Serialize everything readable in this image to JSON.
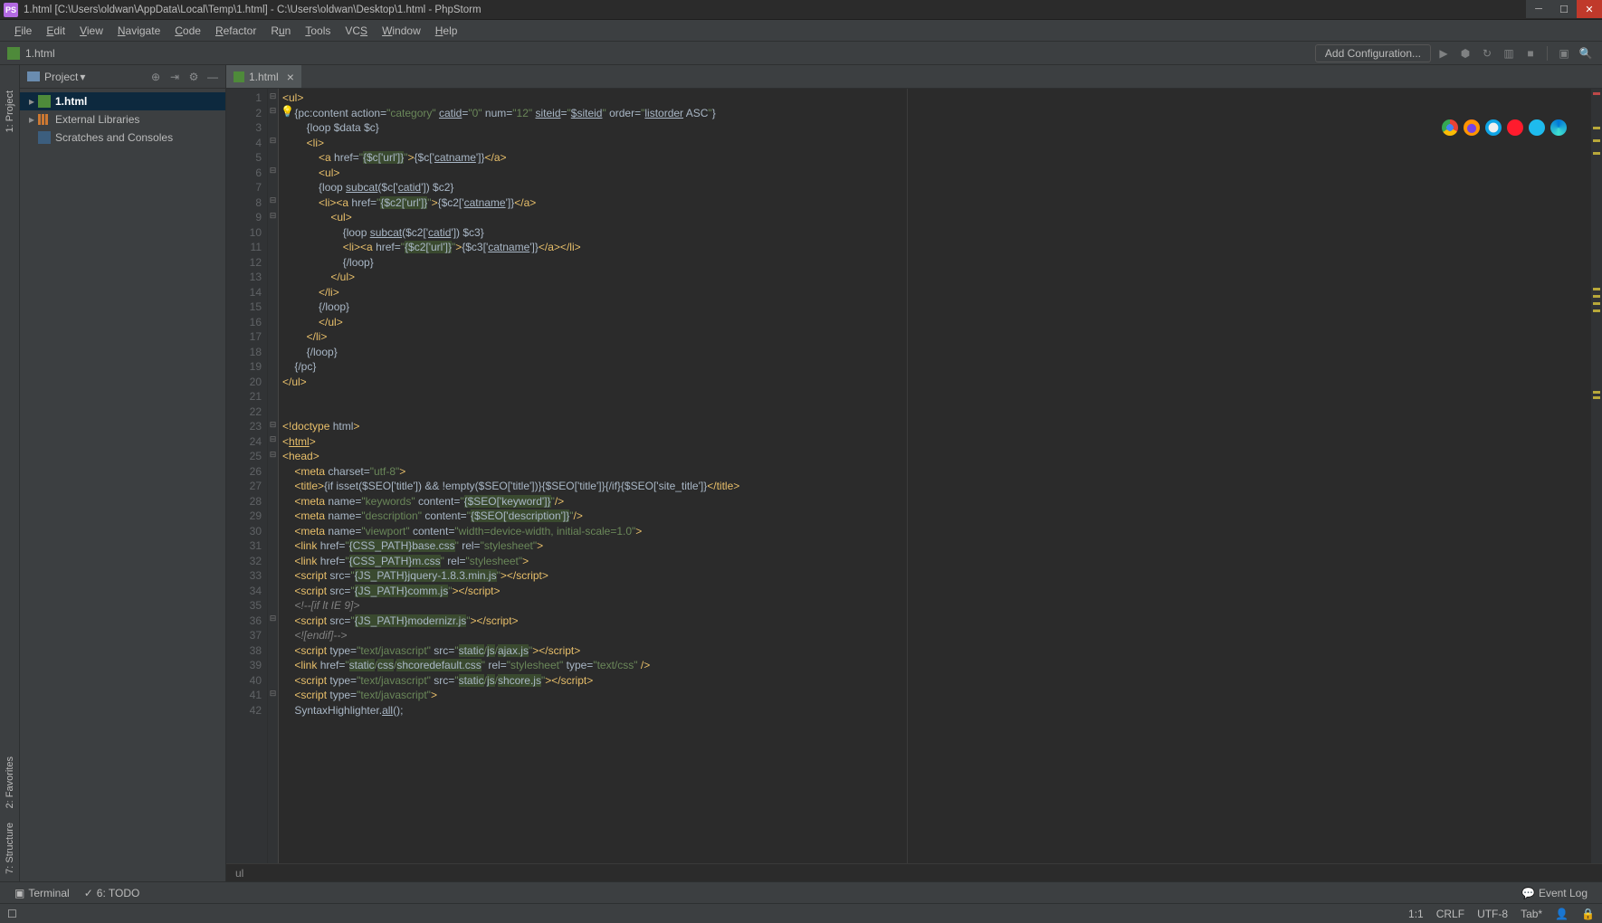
{
  "titlebar": {
    "text": "1.html [C:\\Users\\oldwan\\AppData\\Local\\Temp\\1.html] - C:\\Users\\oldwan\\Desktop\\1.html - PhpStorm"
  },
  "menu": {
    "items": [
      "File",
      "Edit",
      "View",
      "Navigate",
      "Code",
      "Refactor",
      "Run",
      "Tools",
      "VCS",
      "Window",
      "Help"
    ]
  },
  "navbar": {
    "file": "1.html",
    "addConfig": "Add Configuration..."
  },
  "leftTabs": {
    "project": "1: Project",
    "favorites": "2: Favorites",
    "structure": "7: Structure"
  },
  "projectPanel": {
    "title": "Project",
    "tree": {
      "root": "1.html",
      "ext": "External Libraries",
      "scratch": "Scratches and Consoles"
    }
  },
  "tabs": {
    "active": "1.html"
  },
  "gutterStart": 1,
  "gutterEnd": 42,
  "code": {
    "lines": [
      {
        "n": 1,
        "html": "<span class='t'>&lt;ul&gt;</span>"
      },
      {
        "n": 2,
        "html": "    <span class='a'>{pc:content action=</span><span class='s'>\"category\"</span> <span class='a u'>catid</span><span class='a'>=</span><span class='s'>\"0\"</span> <span class='a'>num=</span><span class='s'>\"12\"</span> <span class='a u'>siteid</span><span class='a'>=</span><span class='s'>\"</span><span class='a u'>$siteid</span><span class='s'>\"</span> <span class='a'>order=</span><span class='s'>\"</span><span class='a u'>listorder</span> <span class='a'>ASC</span><span class='s'>\"</span><span class='a'>}</span>"
      },
      {
        "n": 3,
        "html": "        <span class='a'>{loop $data $c}</span>"
      },
      {
        "n": 4,
        "html": "        <span class='t'>&lt;li&gt;</span>"
      },
      {
        "n": 5,
        "html": "            <span class='t'>&lt;a </span><span class='a'>href=</span><span class='s'>\"</span><span class='sh'>{$c['url']}</span><span class='s'>\"</span><span class='t'>&gt;</span><span class='a'>{$c['</span><span class='a u'>catname</span><span class='a'>']}</span><span class='t'>&lt;/a&gt;</span>"
      },
      {
        "n": 6,
        "html": "            <span class='t'>&lt;ul&gt;</span>"
      },
      {
        "n": 7,
        "html": "            <span class='a'>{loop </span><span class='a u'>subcat</span><span class='a'>($c['</span><span class='a u'>catid</span><span class='a'>']) $c2}</span>"
      },
      {
        "n": 8,
        "html": "            <span class='t'>&lt;li&gt;&lt;a </span><span class='a'>href=</span><span class='s'>\"</span><span class='sh'>{$c2['url']}</span><span class='s'>\"</span><span class='t'>&gt;</span><span class='a'>{$c2['</span><span class='a u'>catname</span><span class='a'>']}</span><span class='t'>&lt;/a&gt;</span>"
      },
      {
        "n": 9,
        "html": "                <span class='t'>&lt;ul&gt;</span>"
      },
      {
        "n": 10,
        "html": "                    <span class='a'>{loop </span><span class='a u'>subcat</span><span class='a'>($c2['</span><span class='a u'>catid</span><span class='a'>']) $c3}</span>"
      },
      {
        "n": 11,
        "html": "                    <span class='t'>&lt;li&gt;&lt;a </span><span class='a'>href=</span><span class='s'>\"</span><span class='sh'>{$c2['url']}</span><span class='s'>\"</span><span class='t'>&gt;</span><span class='a'>{$c3['</span><span class='a u'>catname</span><span class='a'>']}</span><span class='t'>&lt;/a&gt;&lt;/li&gt;</span>"
      },
      {
        "n": 12,
        "html": "                    <span class='a'>{/loop}</span>"
      },
      {
        "n": 13,
        "html": "                <span class='t'>&lt;/ul&gt;</span>"
      },
      {
        "n": 14,
        "html": "            <span class='t'>&lt;/li&gt;</span>"
      },
      {
        "n": 15,
        "html": "            <span class='a'>{/loop}</span>"
      },
      {
        "n": 16,
        "html": "            <span class='t'>&lt;/ul&gt;</span>"
      },
      {
        "n": 17,
        "html": "        <span class='t'>&lt;/li&gt;</span>"
      },
      {
        "n": 18,
        "html": "        <span class='a'>{/loop}</span>"
      },
      {
        "n": 19,
        "html": "    <span class='a'>{/pc}</span>"
      },
      {
        "n": 20,
        "html": "<span class='t'>&lt;/ul&gt;</span>"
      },
      {
        "n": 21,
        "html": ""
      },
      {
        "n": 22,
        "html": ""
      },
      {
        "n": 23,
        "html": "<span class='t'>&lt;!doctype </span><span class='a'>html</span><span class='t'>&gt;</span>"
      },
      {
        "n": 24,
        "html": "<span class='t'>&lt;</span><span class='t u'>html</span><span class='t'>&gt;</span>"
      },
      {
        "n": 25,
        "html": "<span class='t'>&lt;head&gt;</span>"
      },
      {
        "n": 26,
        "html": "    <span class='t'>&lt;meta </span><span class='a'>charset=</span><span class='s'>\"utf-8\"</span><span class='t'>&gt;</span>"
      },
      {
        "n": 27,
        "html": "    <span class='t'>&lt;title&gt;</span><span class='a'>{if isset($SEO['title']) && !empty($SEO['title'])}{$SEO['title']}{/if}{$SEO['site_title']}</span><span class='t'>&lt;/title&gt;</span>"
      },
      {
        "n": 28,
        "html": "    <span class='t'>&lt;meta </span><span class='a'>name=</span><span class='s'>\"keywords\"</span> <span class='a'>content=</span><span class='s'>\"</span><span class='sh'>{$SEO['keyword']}</span><span class='s'>\"</span><span class='t'>/&gt;</span>"
      },
      {
        "n": 29,
        "html": "    <span class='t'>&lt;meta </span><span class='a'>name=</span><span class='s'>\"description\"</span> <span class='a'>content=</span><span class='s'>\"</span><span class='sh'>{$SEO['description']}</span><span class='s'>\"</span><span class='t'>/&gt;</span>"
      },
      {
        "n": 30,
        "html": "    <span class='t'>&lt;meta </span><span class='a'>name=</span><span class='s'>\"viewport\"</span> <span class='a'>content=</span><span class='s'>\"width=device-width, initial-scale=1.0\"</span><span class='t'>&gt;</span>"
      },
      {
        "n": 31,
        "html": "    <span class='t'>&lt;link </span><span class='a'>href=</span><span class='s'>\"</span><span class='sh'>{CSS_PATH}base.css</span><span class='s'>\"</span> <span class='a'>rel=</span><span class='s'>\"stylesheet\"</span><span class='t'>&gt;</span>"
      },
      {
        "n": 32,
        "html": "    <span class='t'>&lt;link </span><span class='a'>href=</span><span class='s'>\"</span><span class='sh'>{CSS_PATH}m.css</span><span class='s'>\"</span> <span class='a'>rel=</span><span class='s'>\"stylesheet\"</span><span class='t'>&gt;</span>"
      },
      {
        "n": 33,
        "html": "    <span class='t'>&lt;script </span><span class='a'>src=</span><span class='s'>\"</span><span class='sh'>{JS_PATH}jquery-1.8.3.min.js</span><span class='s'>\"</span><span class='t'>&gt;&lt;/script&gt;</span>"
      },
      {
        "n": 34,
        "html": "    <span class='t'>&lt;script </span><span class='a'>src=</span><span class='s'>\"</span><span class='sh'>{JS_PATH}comm.js</span><span class='s'>\"</span><span class='t'>&gt;&lt;/script&gt;</span>"
      },
      {
        "n": 35,
        "html": "    <span class='ci'>&lt;!--[if lt IE 9]&gt;</span>"
      },
      {
        "n": 36,
        "html": "    <span class='t'>&lt;script </span><span class='a'>src=</span><span class='s'>\"</span><span class='sh'>{JS_PATH}modernizr.js</span><span class='s'>\"</span><span class='t'>&gt;&lt;/script&gt;</span>"
      },
      {
        "n": 37,
        "html": "    <span class='ci'>&lt;![endif]--&gt;</span>"
      },
      {
        "n": 38,
        "html": "    <span class='t'>&lt;script </span><span class='a'>type=</span><span class='s'>\"text/javascript\"</span> <span class='a'>src=</span><span class='s'>\"</span><span class='sh'>static</span><span class='s'>/</span><span class='sh'>js</span><span class='s'>/</span><span class='sh'>ajax.js</span><span class='s'>\"</span><span class='t'>&gt;&lt;/script&gt;</span>"
      },
      {
        "n": 39,
        "html": "    <span class='t'>&lt;link </span><span class='a'>href=</span><span class='s'>\"</span><span class='sh'>static</span><span class='s'>/</span><span class='sh'>css</span><span class='s'>/</span><span class='sh'>shcoredefault.css</span><span class='s'>\"</span> <span class='a'>rel=</span><span class='s'>\"stylesheet\"</span> <span class='a'>type=</span><span class='s'>\"text/css\"</span> <span class='t'>/&gt;</span>"
      },
      {
        "n": 40,
        "html": "    <span class='t'>&lt;script </span><span class='a'>type=</span><span class='s'>\"text/javascript\"</span> <span class='a'>src=</span><span class='s'>\"</span><span class='sh'>static</span><span class='s'>/</span><span class='sh'>js</span><span class='s'>/</span><span class='sh'>shcore.js</span><span class='s'>\"</span><span class='t'>&gt;&lt;/script&gt;</span>"
      },
      {
        "n": 41,
        "html": "    <span class='t'>&lt;script </span><span class='a'>type=</span><span class='s'>\"text/javascript\"</span><span class='t'>&gt;</span>"
      },
      {
        "n": 42,
        "html": "    <span class='a'>SyntaxHighlighter.</span><span class='a u'>all</span><span class='a'>();</span>"
      }
    ]
  },
  "breadcrumb": "ul",
  "bottomBar": {
    "terminal": "Terminal",
    "todo": "6: TODO",
    "eventLog": "Event Log"
  },
  "statusbar": {
    "pos": "1:1",
    "lineEnd": "CRLF",
    "encoding": "UTF-8",
    "indent": "Tab*"
  },
  "browserIcons": [
    "chrome",
    "ff",
    "safari",
    "opera",
    "ie",
    "edge"
  ]
}
